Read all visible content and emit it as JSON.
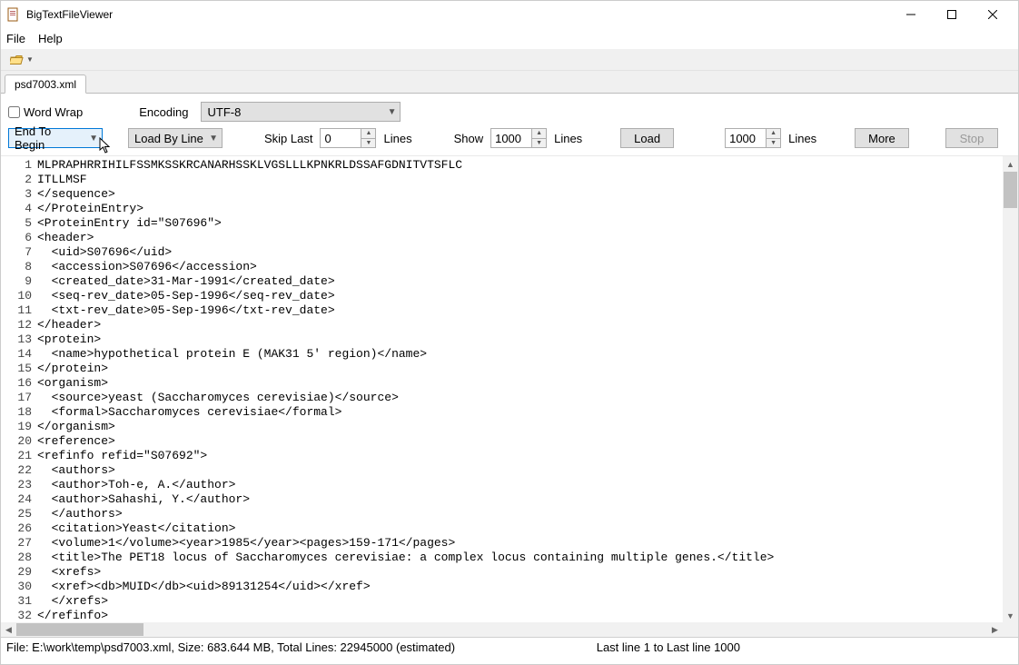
{
  "title": "BigTextFileViewer",
  "menu": {
    "file": "File",
    "help": "Help"
  },
  "tab": {
    "label": "psd7003.xml"
  },
  "options": {
    "wordwrap_label": "Word Wrap",
    "wordwrap_checked": false,
    "encoding_label": "Encoding",
    "encoding_value": "UTF-8",
    "direction_value": "End To Begin",
    "loadmode_value": "Load By Line",
    "skiplast_label": "Skip Last",
    "skiplast_value": "0",
    "skiplast_unit": "Lines",
    "show_label": "Show",
    "show_value": "1000",
    "show_unit": "Lines",
    "load_btn": "Load",
    "more_value": "1000",
    "more_unit": "Lines",
    "more_btn": "More",
    "stop_btn": "Stop"
  },
  "code": {
    "start_line": 1,
    "lines": [
      "MLPRAPHRRIHILFSSMKSSKRCANARHSSKLVGSLLLKPNKRLDSSAFGDNITVTSFLC",
      "ITLLMSF",
      "</sequence>",
      "</ProteinEntry>",
      "<ProteinEntry id=\"S07696\">",
      "<header>",
      "  <uid>S07696</uid>",
      "  <accession>S07696</accession>",
      "  <created_date>31-Mar-1991</created_date>",
      "  <seq-rev_date>05-Sep-1996</seq-rev_date>",
      "  <txt-rev_date>05-Sep-1996</txt-rev_date>",
      "</header>",
      "<protein>",
      "  <name>hypothetical protein E (MAK31 5' region)</name>",
      "</protein>",
      "<organism>",
      "  <source>yeast (Saccharomyces cerevisiae)</source>",
      "  <formal>Saccharomyces cerevisiae</formal>",
      "</organism>",
      "<reference>",
      "<refinfo refid=\"S07692\">",
      "  <authors>",
      "  <author>Toh-e, A.</author>",
      "  <author>Sahashi, Y.</author>",
      "  </authors>",
      "  <citation>Yeast</citation>",
      "  <volume>1</volume><year>1985</year><pages>159-171</pages>",
      "  <title>The PET18 locus of Saccharomyces cerevisiae: a complex locus containing multiple genes.</title>",
      "  <xrefs>",
      "  <xref><db>MUID</db><uid>89131254</uid></xref>",
      "  </xrefs>",
      "</refinfo>"
    ]
  },
  "status": {
    "left": "File: E:\\work\\temp\\psd7003.xml, Size: 683.644 MB, Total Lines: 22945000 (estimated)",
    "right": "Last line 1 to Last line 1000"
  }
}
